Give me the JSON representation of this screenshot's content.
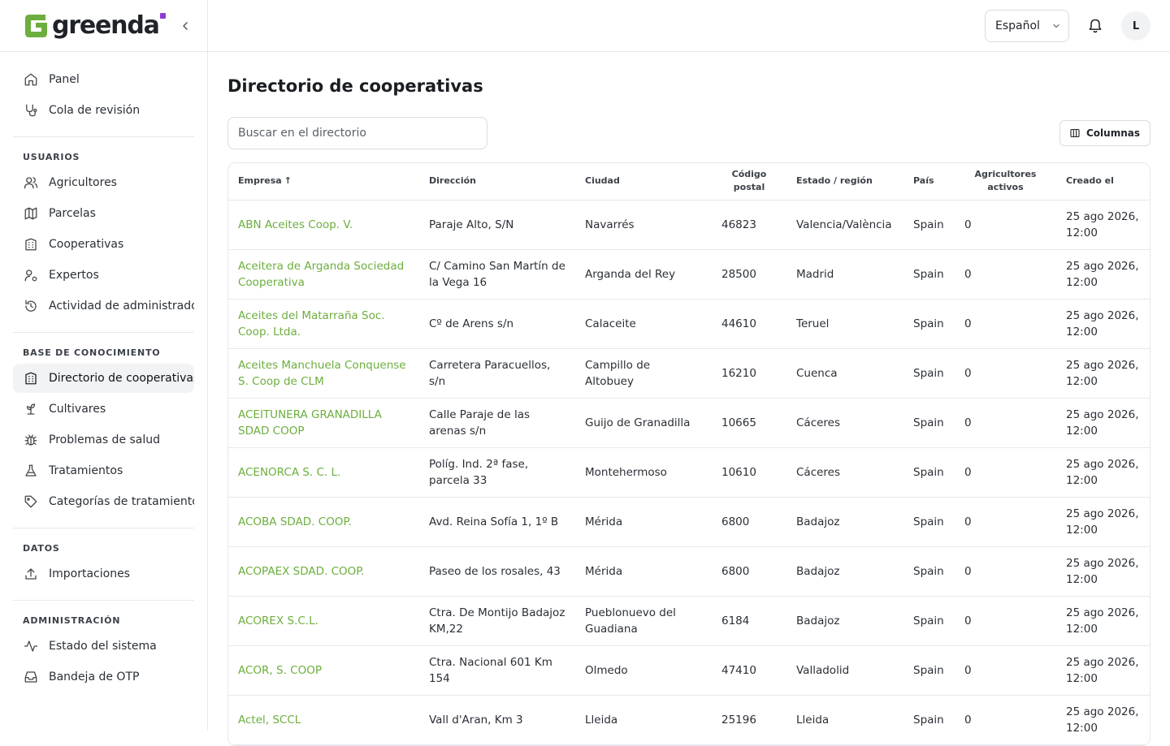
{
  "brand": {
    "name": "greenda"
  },
  "language": {
    "selected": "Español"
  },
  "user": {
    "initial": "L"
  },
  "nav": {
    "primary": [
      {
        "label": "Panel",
        "icon": "home-icon"
      },
      {
        "label": "Cola de revisión",
        "icon": "stethoscope-icon"
      }
    ],
    "groups": [
      {
        "title": "USUARIOS",
        "items": [
          {
            "label": "Agricultores",
            "icon": "users-icon"
          },
          {
            "label": "Parcelas",
            "icon": "map-icon"
          },
          {
            "label": "Cooperativas",
            "icon": "building-icon"
          },
          {
            "label": "Expertos",
            "icon": "user-cog-icon"
          },
          {
            "label": "Actividad de administrador",
            "icon": "history-icon"
          }
        ]
      },
      {
        "title": "BASE DE CONOCIMIENTO",
        "items": [
          {
            "label": "Directorio de cooperativas",
            "icon": "building-icon",
            "active": true
          },
          {
            "label": "Cultivares",
            "icon": "sprout-icon"
          },
          {
            "label": "Problemas de salud",
            "icon": "bug-icon"
          },
          {
            "label": "Tratamientos",
            "icon": "flask-icon"
          },
          {
            "label": "Categorías de tratamiento",
            "icon": "tag-icon"
          }
        ]
      },
      {
        "title": "DATOS",
        "items": [
          {
            "label": "Importaciones",
            "icon": "upload-icon"
          }
        ]
      },
      {
        "title": "ADMINISTRACIÓN",
        "items": [
          {
            "label": "Estado del sistema",
            "icon": "activity-icon"
          },
          {
            "label": "Bandeja de OTP",
            "icon": "inbox-icon"
          }
        ]
      }
    ]
  },
  "page": {
    "title": "Directorio de cooperativas",
    "search_placeholder": "Buscar en el directorio",
    "columns_label": "Columnas"
  },
  "table": {
    "columns": [
      {
        "label": "Empresa",
        "sort": "↑"
      },
      {
        "label": "Dirección"
      },
      {
        "label": "Ciudad"
      },
      {
        "label": "Código postal",
        "center": true
      },
      {
        "label": "Estado / región"
      },
      {
        "label": "País"
      },
      {
        "label": "Agricultores activos",
        "center": true
      },
      {
        "label": "Creado el"
      }
    ],
    "rows": [
      {
        "company": "ABN Aceites Coop. V.",
        "address": "Paraje Alto, S/N",
        "city": "Navarrés",
        "postal": "46823",
        "region": "Valencia/València",
        "country": "Spain",
        "farmers": "0",
        "created": "25 ago 2026, 12:00"
      },
      {
        "company": "Aceitera de Arganda Sociedad Cooperativa",
        "address": "C/ Camino San Martín de la Vega 16",
        "city": "Arganda del Rey",
        "postal": "28500",
        "region": "Madrid",
        "country": "Spain",
        "farmers": "0",
        "created": "25 ago 2026, 12:00"
      },
      {
        "company": "Aceites del Matarraña Soc. Coop. Ltda.",
        "address": "Cº de Arens s/n",
        "city": "Calaceite",
        "postal": "44610",
        "region": "Teruel",
        "country": "Spain",
        "farmers": "0",
        "created": "25 ago 2026, 12:00"
      },
      {
        "company": "Aceites Manchuela Conquense S. Coop de CLM",
        "address": "Carretera Paracuellos, s/n",
        "city": "Campillo de Altobuey",
        "postal": "16210",
        "region": "Cuenca",
        "country": "Spain",
        "farmers": "0",
        "created": "25 ago 2026, 12:00"
      },
      {
        "company": "ACEITUNERA GRANADILLA SDAD COOP",
        "address": "Calle Paraje de las arenas s/n",
        "city": "Guijo de Granadilla",
        "postal": "10665",
        "region": "Cáceres",
        "country": "Spain",
        "farmers": "0",
        "created": "25 ago 2026, 12:00"
      },
      {
        "company": "ACENORCA S. C. L.",
        "address": "Políg. Ind. 2ª fase, parcela 33",
        "city": "Montehermoso",
        "postal": "10610",
        "region": "Cáceres",
        "country": "Spain",
        "farmers": "0",
        "created": "25 ago 2026, 12:00"
      },
      {
        "company": "ACOBA SDAD. COOP.",
        "address": "Avd. Reina Sofía 1, 1º B",
        "city": "Mérida",
        "postal": "6800",
        "region": "Badajoz",
        "country": "Spain",
        "farmers": "0",
        "created": "25 ago 2026, 12:00"
      },
      {
        "company": "ACOPAEX SDAD. COOP.",
        "address": "Paseo de los rosales, 43",
        "city": "Mérida",
        "postal": "6800",
        "region": "Badajoz",
        "country": "Spain",
        "farmers": "0",
        "created": "25 ago 2026, 12:00"
      },
      {
        "company": "ACOREX S.C.L.",
        "address": "Ctra. De Montijo Badajoz KM,22",
        "city": "Pueblonuevo del Guadiana",
        "postal": "6184",
        "region": "Badajoz",
        "country": "Spain",
        "farmers": "0",
        "created": "25 ago 2026, 12:00"
      },
      {
        "company": "ACOR, S. COOP",
        "address": "Ctra. Nacional 601 Km 154",
        "city": "Olmedo",
        "postal": "47410",
        "region": "Valladolid",
        "country": "Spain",
        "farmers": "0",
        "created": "25 ago 2026, 12:00"
      },
      {
        "company": "Actel, SCCL",
        "address": "Vall d'Aran, Km 3",
        "city": "Lleida",
        "postal": "25196",
        "region": "Lleida",
        "country": "Spain",
        "farmers": "0",
        "created": "25 ago 2026, 12:00"
      }
    ]
  },
  "colors": {
    "accent": "#6cae3e",
    "brand_dot": "#8b3dd6",
    "border": "#e6e8eb"
  }
}
